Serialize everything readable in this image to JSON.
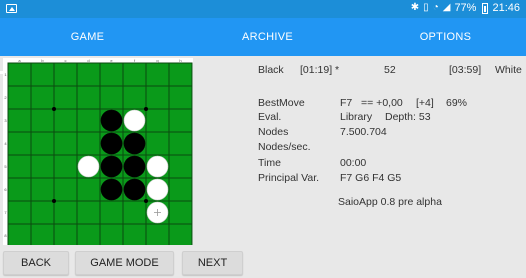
{
  "status_bar": {
    "icons": [
      "gallery-icon",
      "bluetooth-icon",
      "vibrate-icon",
      "wifi-icon",
      "signal-icon",
      "battery-icon"
    ],
    "battery": "77%",
    "time": "21:46"
  },
  "tabs": [
    {
      "label": "GAME",
      "selected": true
    },
    {
      "label": "ARCHIVE",
      "selected": false
    },
    {
      "label": "OPTIONS",
      "selected": false
    }
  ],
  "colors": {
    "status_bar": "#1c8ed8",
    "tab_bar": "#2196f3",
    "board": "#0a9a1a",
    "background": "#e8e8e8"
  },
  "board": {
    "columns": [
      "a",
      "b",
      "c",
      "d",
      "e",
      "f",
      "g",
      "h"
    ],
    "rows": [
      "1",
      "2",
      "3",
      "4",
      "5",
      "6",
      "7",
      "8"
    ],
    "discs": [
      {
        "square": "e3",
        "color": "black"
      },
      {
        "square": "f3",
        "color": "white"
      },
      {
        "square": "e4",
        "color": "black"
      },
      {
        "square": "f4",
        "color": "black"
      },
      {
        "square": "d5",
        "color": "white"
      },
      {
        "square": "e5",
        "color": "black"
      },
      {
        "square": "f5",
        "color": "black"
      },
      {
        "square": "g5",
        "color": "white"
      },
      {
        "square": "e6",
        "color": "black"
      },
      {
        "square": "f6",
        "color": "black"
      },
      {
        "square": "g6",
        "color": "white"
      },
      {
        "square": "g7",
        "color": "white",
        "last_move": true
      }
    ],
    "star_points": [
      "c3",
      "g3",
      "c7",
      "g7"
    ]
  },
  "score": {
    "black_label": "Black",
    "black_time": "[01:19] *",
    "count": "52",
    "white_time": "[03:59]",
    "white_label": "White"
  },
  "analysis": {
    "best_move_label": "BestMove",
    "best_move": "F7",
    "best_eval": "== +0,00",
    "depth_bracket": "[+4]",
    "percent": "69%",
    "eval_label": "Eval.",
    "eval_source": "Library",
    "depth_text": "Depth: 53",
    "nodes_label": "Nodes",
    "nodes_value": "7.500.704",
    "nodes_sec_label": "Nodes/sec.",
    "nodes_sec_value": "",
    "time_label": "Time",
    "time_value": "00:00",
    "pv_label": "Principal Var.",
    "pv_value": "F7 G6 F4 G5"
  },
  "app_version": "SaioApp 0.8 pre alpha",
  "buttons": {
    "back": "BACK",
    "game_mode": "GAME MODE",
    "next": "NEXT"
  }
}
